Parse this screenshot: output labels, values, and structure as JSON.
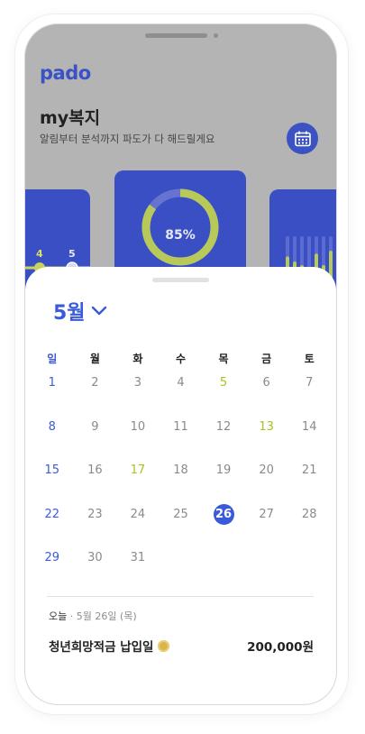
{
  "app": {
    "logo": "pado"
  },
  "header": {
    "title": "my복지",
    "subtitle": "알림부터 분석까지 파도가  다 해드릴게요"
  },
  "cards": {
    "left": {
      "labels": [
        "4",
        "5"
      ]
    },
    "center": {
      "percent_label": "85%",
      "progress": 0.85
    },
    "right": {
      "bars": [
        0.82,
        0.75,
        0.7,
        0.62,
        0.86,
        0.7,
        0.9
      ]
    }
  },
  "calendar": {
    "month_label": "5월",
    "weekdays": [
      "일",
      "월",
      "화",
      "수",
      "목",
      "금",
      "토"
    ],
    "weeks": [
      [
        "1",
        "2",
        "3",
        "4",
        "5",
        "6",
        "7"
      ],
      [
        "8",
        "9",
        "10",
        "11",
        "12",
        "13",
        "14"
      ],
      [
        "15",
        "16",
        "17",
        "18",
        "19",
        "20",
        "21"
      ],
      [
        "22",
        "23",
        "24",
        "25",
        "26",
        "27",
        "28"
      ],
      [
        "29",
        "30",
        "31",
        "",
        "",
        "",
        ""
      ]
    ],
    "event_days": [
      "5",
      "13",
      "17"
    ],
    "selected_day": "26"
  },
  "today": {
    "label": "오늘",
    "separator": "·",
    "date": "5월 26일 (목)"
  },
  "event": {
    "name": "청년희망적금 납입일",
    "amount": "200,000원"
  },
  "colors": {
    "accent": "#3a5bd9",
    "card": "#3b4fc4",
    "event_day": "#a9c31e",
    "chart_lime": "#b8c95a"
  }
}
